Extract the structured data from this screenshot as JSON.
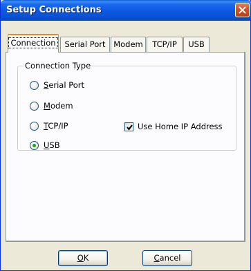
{
  "window": {
    "title": "Setup Connections"
  },
  "tabs": [
    {
      "label": "Connection",
      "active": true
    },
    {
      "label": "Serial Port",
      "active": false
    },
    {
      "label": "Modem",
      "active": false
    },
    {
      "label": "TCP/IP",
      "active": false
    },
    {
      "label": "USB",
      "active": false
    }
  ],
  "connection_type": {
    "label": "Connection Type",
    "options": [
      {
        "label": "Serial Port",
        "mnemonic": "S",
        "rest": "erial Port",
        "checked": false
      },
      {
        "label": "Modem",
        "mnemonic": "M",
        "rest": "odem",
        "checked": false
      },
      {
        "label": "TCP/IP",
        "mnemonic": "T",
        "rest": "CP/IP",
        "checked": false
      },
      {
        "label": "USB",
        "mnemonic": "U",
        "rest": "SB",
        "checked": true
      }
    ],
    "use_home_ip": {
      "label": "Use Home IP Address",
      "checked": true
    }
  },
  "buttons": {
    "ok": {
      "mnemonic": "O",
      "rest": "K"
    },
    "cancel": {
      "mnemonic": "C",
      "rest": "ancel"
    }
  },
  "colors": {
    "titlebar": "#0b58e0",
    "close": "#d3512a",
    "active_tab_accent": "#e68b2c",
    "radio_dot": "#21a121"
  }
}
